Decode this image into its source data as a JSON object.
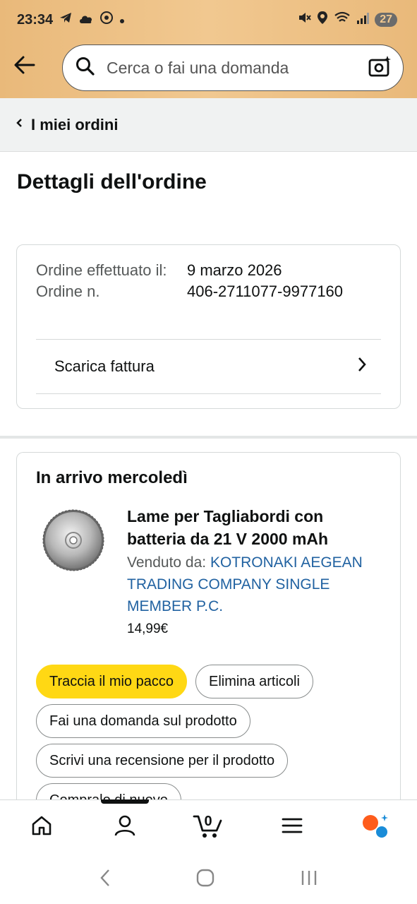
{
  "status_bar": {
    "time": "23:34",
    "battery": "27"
  },
  "search": {
    "placeholder": "Cerca o fai una domanda"
  },
  "breadcrumb": {
    "label": "I miei ordini"
  },
  "page": {
    "title": "Dettagli dell'ordine"
  },
  "order_info": {
    "placed_label": "Ordine effettuato il:",
    "number_label": "Ordine n.",
    "placed_value": "9 marzo 2026",
    "number_value": "406-2711077-9977160",
    "invoice_label": "Scarica fattura"
  },
  "delivery": {
    "title": "In arrivo mercoledì",
    "product": {
      "name": "Lame per Tagliabordi con batteria da 21 V 2000 mAh",
      "seller_label": "Venduto da:",
      "seller_name": "KOTRONAKI AEGEAN TRADING COMPANY SINGLE MEMBER P.C.",
      "price": "14,99€"
    },
    "actions": {
      "track": "Traccia il mio pacco",
      "delete": "Elimina articoli",
      "ask": "Fai una domanda sul prodotto",
      "review": "Scrivi una recensione per il prodotto",
      "buy_again": "Compralo di nuovo"
    }
  },
  "bottom_nav": {
    "cart_count": "0"
  },
  "colors": {
    "header": "#f1c890",
    "primary_button": "#ffd814",
    "link": "#2162a1",
    "rufus_orange": "#fe5c1c",
    "rufus_blue": "#1a8cd8"
  }
}
